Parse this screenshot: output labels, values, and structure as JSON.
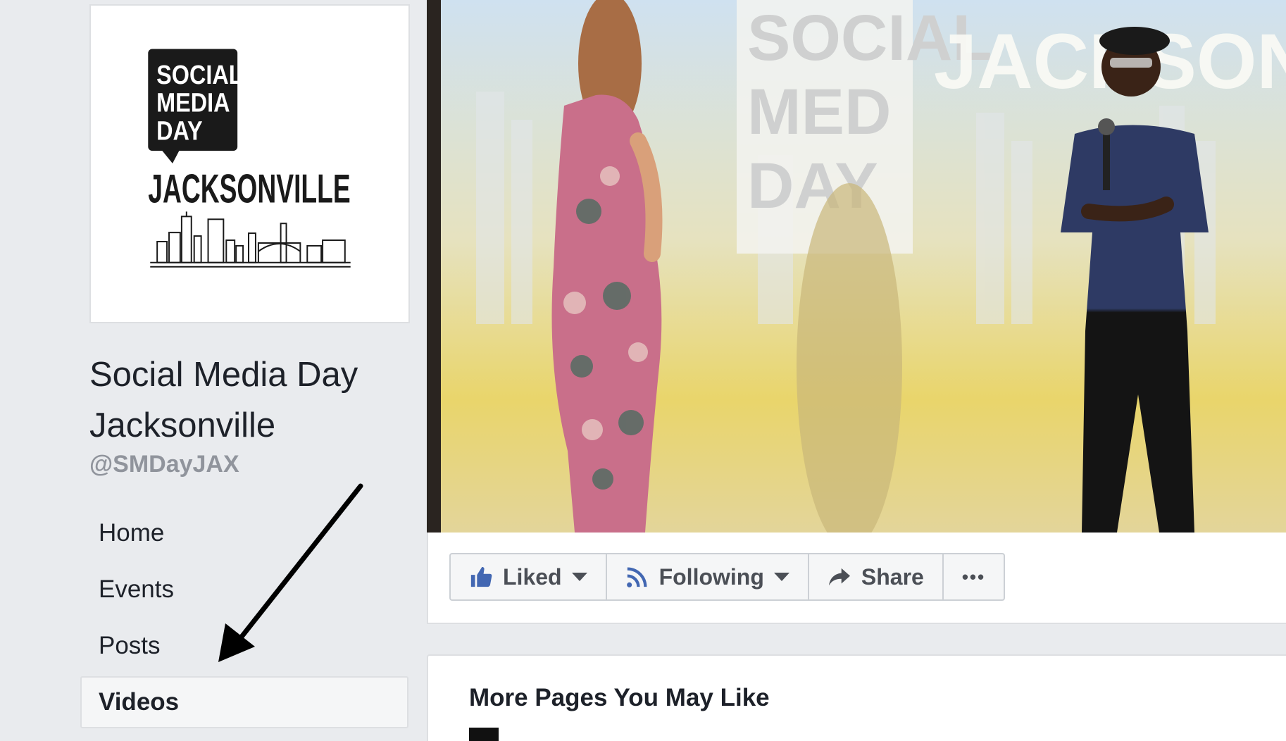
{
  "sidebar": {
    "logo": {
      "line1": "SOCIAL",
      "line2": "MEDIA",
      "line3": "DAY",
      "city": "JACKSONVILLE"
    },
    "page_name": "Social Media Day Jacksonville",
    "handle": "@SMDayJAX",
    "nav": [
      {
        "label": "Home",
        "active": false
      },
      {
        "label": "Events",
        "active": false
      },
      {
        "label": "Posts",
        "active": false
      },
      {
        "label": "Videos",
        "active": true
      }
    ]
  },
  "cover": {
    "backdrop_text_left": [
      "SOCIAL",
      "MED",
      "DAY"
    ],
    "backdrop_text_right": "JACKSONVILLE"
  },
  "actions": {
    "liked_label": "Liked",
    "following_label": "Following",
    "share_label": "Share",
    "more_label": "•••"
  },
  "suggestions": {
    "title": "More Pages You May Like"
  },
  "colors": {
    "brand_blue": "#4267b2",
    "background": "#e9ebee",
    "text_secondary": "#90949c"
  }
}
